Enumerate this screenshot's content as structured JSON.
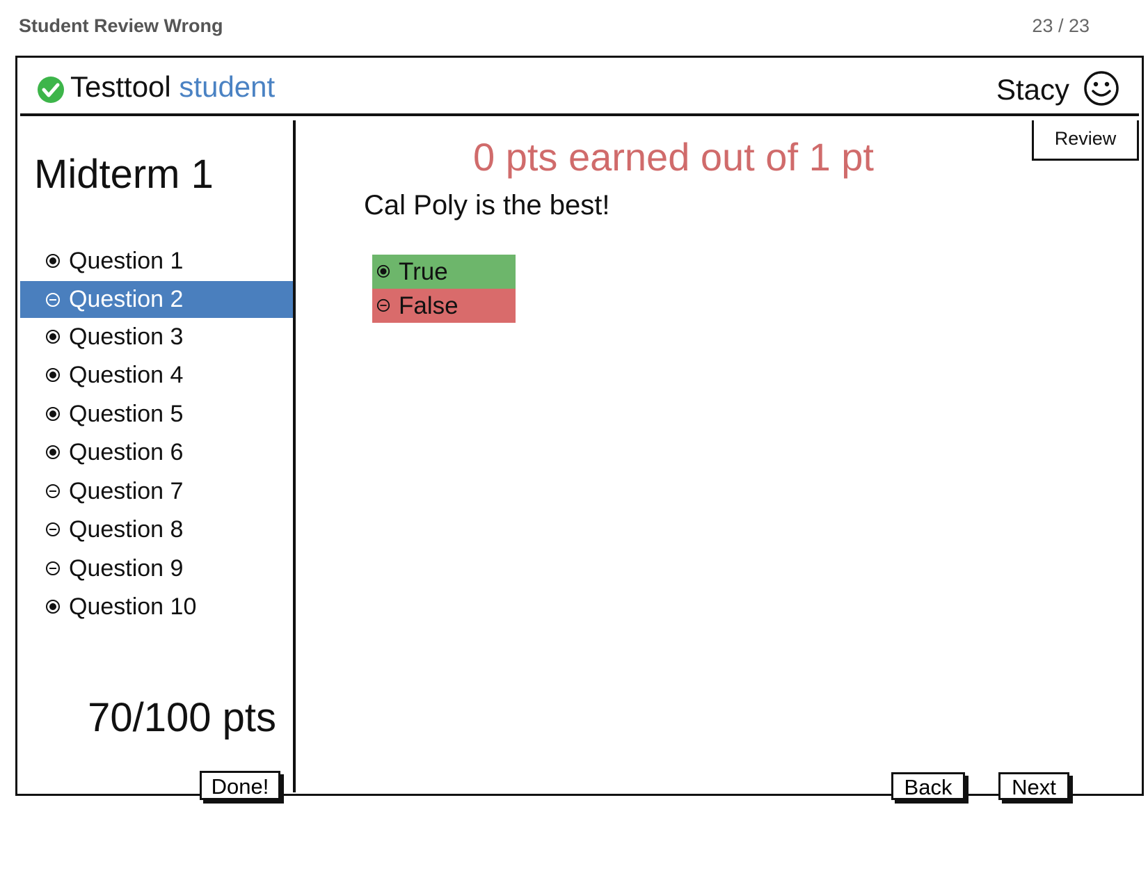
{
  "page": {
    "title": "Student Review Wrong",
    "counter": "23 / 23"
  },
  "header": {
    "brand": "Testtool",
    "brand_accent": "student",
    "user": "Stacy"
  },
  "sidebar": {
    "exam_title": "Midterm 1",
    "questions": [
      {
        "label": "Question 1",
        "icon": "filled-radio-icon"
      },
      {
        "label": "Question 2",
        "icon": "minus-circle-icon",
        "selected": true
      },
      {
        "label": "Question 3",
        "icon": "filled-radio-icon"
      },
      {
        "label": "Question 4",
        "icon": "filled-radio-icon"
      },
      {
        "label": "Question 5",
        "icon": "filled-radio-icon"
      },
      {
        "label": "Question 6",
        "icon": "filled-radio-icon"
      },
      {
        "label": "Question 7",
        "icon": "minus-circle-icon"
      },
      {
        "label": "Question 8",
        "icon": "minus-circle-icon"
      },
      {
        "label": "Question 9",
        "icon": "minus-circle-icon"
      },
      {
        "label": "Question 10",
        "icon": "filled-radio-icon"
      }
    ],
    "score": "70/100 pts",
    "done_label": "Done!"
  },
  "main": {
    "review_tab": "Review",
    "points_text": "0 pts earned out of 1 pt",
    "question": "Cal Poly is the best!",
    "answers": [
      {
        "label": "True",
        "icon": "filled-radio-icon",
        "status": "correct"
      },
      {
        "label": "False",
        "icon": "minus-circle-icon",
        "status": "wrong"
      }
    ],
    "back_label": "Back",
    "next_label": "Next"
  },
  "colors": {
    "accent": "#4a82c3",
    "selected_row": "#4a7fbe",
    "correct": "#6db66b",
    "wrong": "#d96b6b",
    "points": "#d06b6b",
    "check_green": "#3db54a"
  }
}
